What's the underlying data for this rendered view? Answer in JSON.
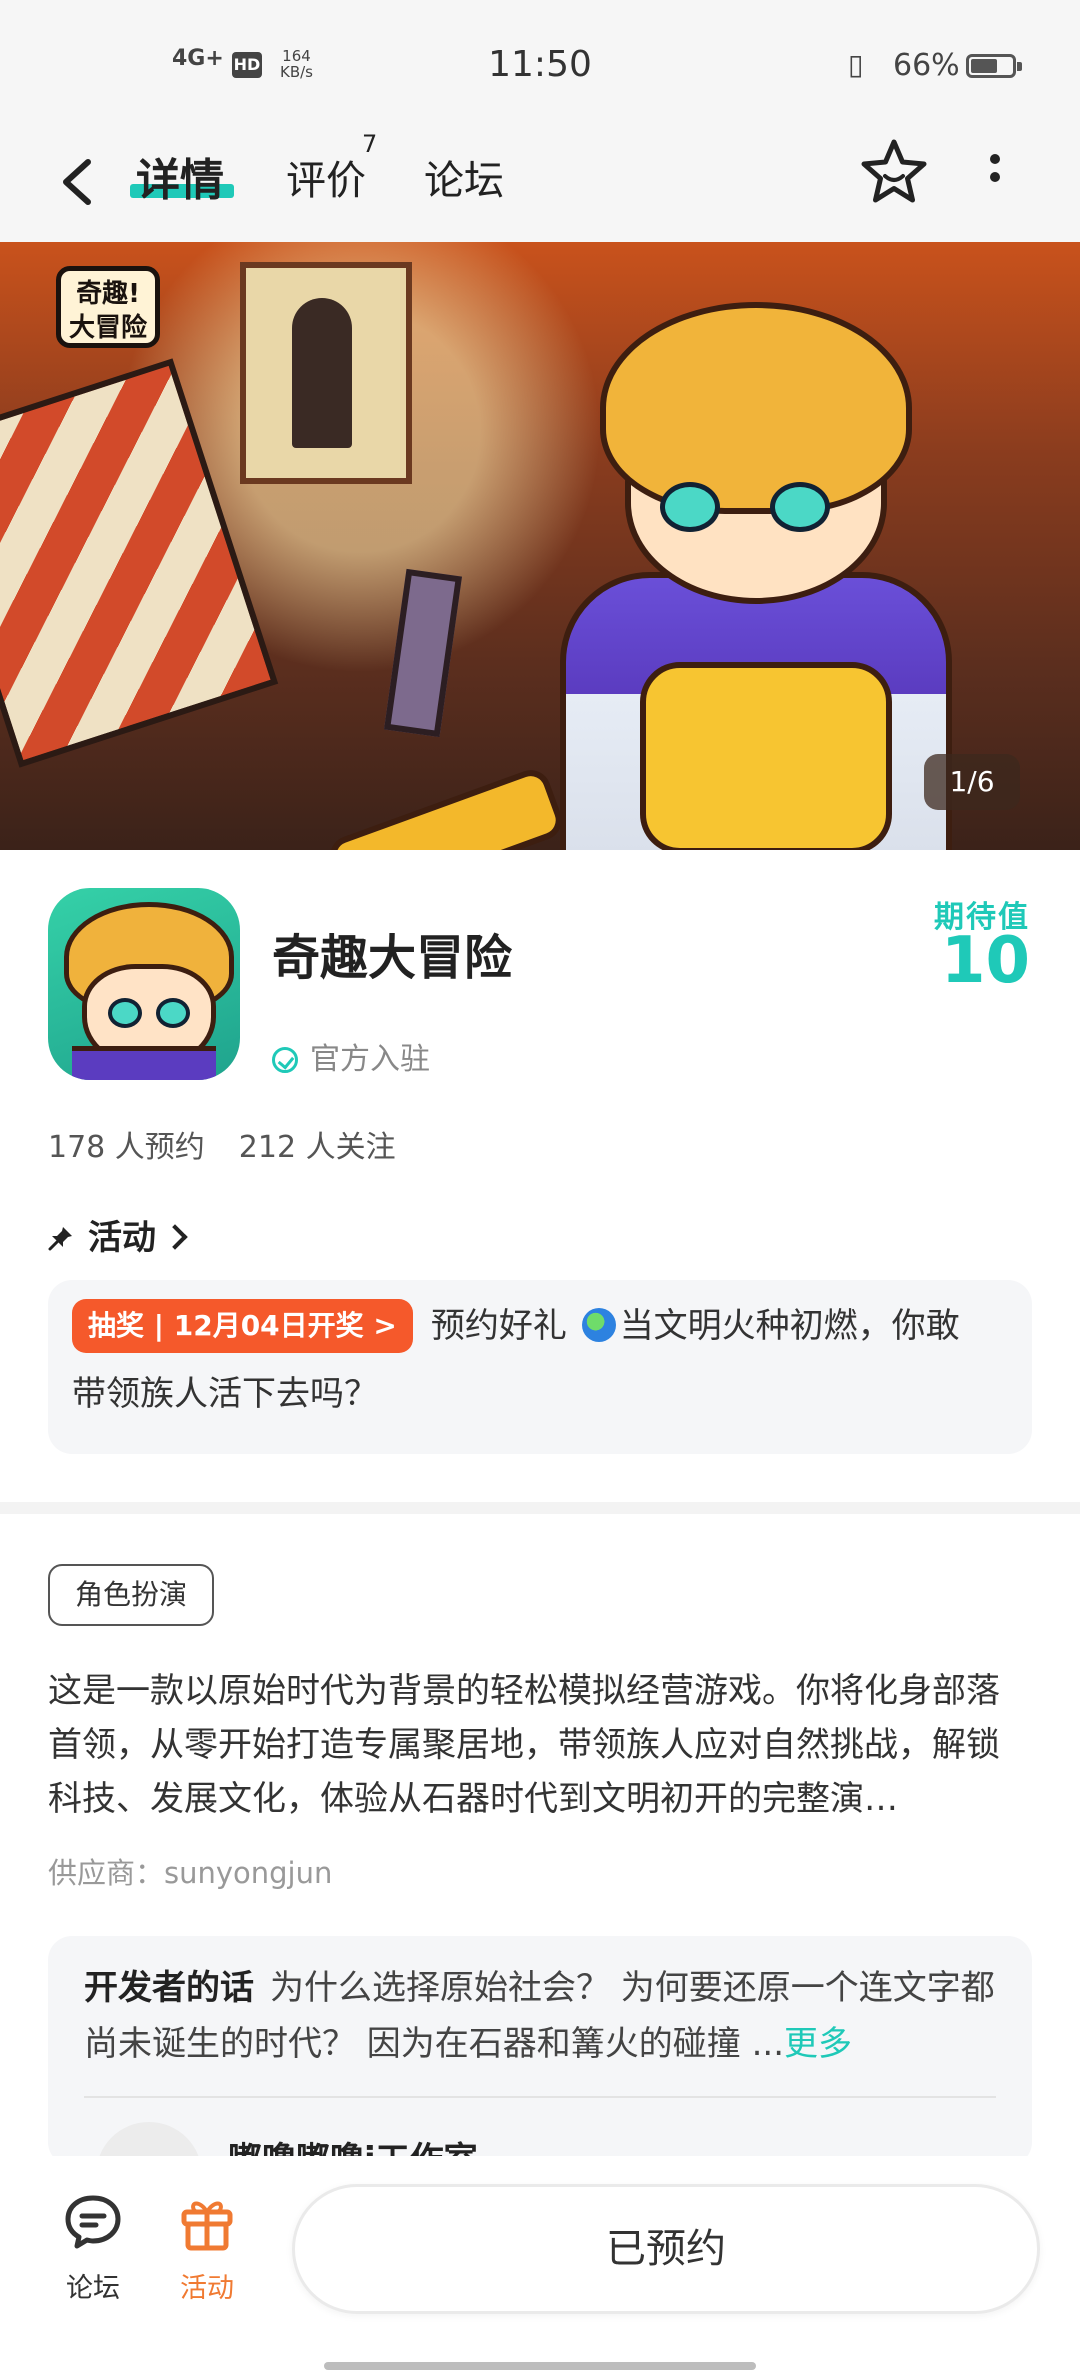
{
  "status_bar": {
    "network": "4G+",
    "hd": "HD",
    "speed_value": "164",
    "speed_unit": "KB/s",
    "time": "11:50",
    "battery_text": "66%",
    "battery_level": 0.66
  },
  "nav": {
    "tabs": [
      {
        "label": "详情",
        "active": true
      },
      {
        "label": "评价",
        "badge": "7"
      },
      {
        "label": "论坛"
      }
    ]
  },
  "banner": {
    "logo_text_line1": "奇趣!",
    "logo_text_line2": "大冒险",
    "counter": "1/6"
  },
  "app": {
    "title": "奇趣大冒险",
    "official_label": "官方入驻",
    "expect_label": "期待值",
    "expect_value": "10",
    "reservations": "178 人预约",
    "followers": "212 人关注"
  },
  "activity": {
    "header": "活动",
    "tag": "抽奖 | 12月04日开奖 >",
    "line1_text": "预约好礼 ",
    "line1_after_globe": "当文明火种初燃，你敢",
    "line2_text": "带领族人活下去吗？"
  },
  "details": {
    "genre_tag": "角色扮演",
    "description": "这是一款以原始时代为背景的轻松模拟经营游戏。你将化身部落首领，从零开始打造专属聚居地，带领族人应对自然挑战，解锁科技、发展文化，体验从石器时代到文明初开的完整演…",
    "supplier": "供应商：sunyongjun"
  },
  "developer": {
    "label": "开发者的话",
    "text": "为什么选择原始社会？ 为何要还原一个连文字都尚未诞生的时代？ 因为在石器和篝火的碰撞 ...",
    "more": "更多",
    "studio": "嘟噜嘟噜i工作室"
  },
  "bottom_bar": {
    "forum_label": "论坛",
    "activity_label": "活动",
    "reserve_button": "已预约"
  },
  "colors": {
    "accent": "#1fc9b8",
    "orange": "#f5592b",
    "activity_tab": "#f07a32"
  },
  "icons": [
    "back-icon",
    "star-icon",
    "more-icon",
    "pin-icon",
    "chevron-right-icon",
    "check-circle-icon",
    "globe-icon",
    "forum-icon",
    "gift-icon"
  ]
}
